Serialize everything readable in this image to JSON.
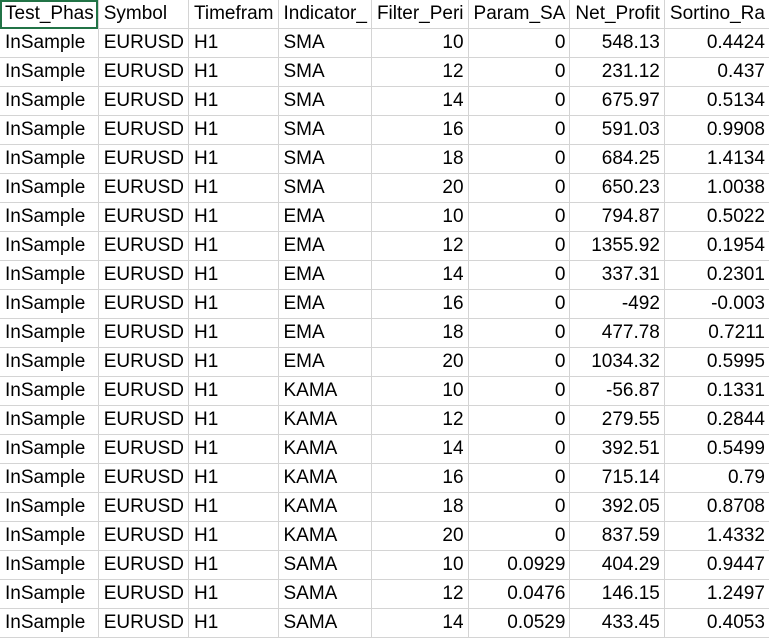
{
  "headers": [
    "Test_Phas",
    "Symbol",
    "Timefram",
    "Indicator_",
    "Filter_Peri",
    "Param_SA",
    "Net_Profit",
    "Sortino_Ra"
  ],
  "rows": [
    [
      "InSample",
      "EURUSD",
      "H1",
      "SMA",
      "10",
      "0",
      "548.13",
      "0.4424"
    ],
    [
      "InSample",
      "EURUSD",
      "H1",
      "SMA",
      "12",
      "0",
      "231.12",
      "0.437"
    ],
    [
      "InSample",
      "EURUSD",
      "H1",
      "SMA",
      "14",
      "0",
      "675.97",
      "0.5134"
    ],
    [
      "InSample",
      "EURUSD",
      "H1",
      "SMA",
      "16",
      "0",
      "591.03",
      "0.9908"
    ],
    [
      "InSample",
      "EURUSD",
      "H1",
      "SMA",
      "18",
      "0",
      "684.25",
      "1.4134"
    ],
    [
      "InSample",
      "EURUSD",
      "H1",
      "SMA",
      "20",
      "0",
      "650.23",
      "1.0038"
    ],
    [
      "InSample",
      "EURUSD",
      "H1",
      "EMA",
      "10",
      "0",
      "794.87",
      "0.5022"
    ],
    [
      "InSample",
      "EURUSD",
      "H1",
      "EMA",
      "12",
      "0",
      "1355.92",
      "0.1954"
    ],
    [
      "InSample",
      "EURUSD",
      "H1",
      "EMA",
      "14",
      "0",
      "337.31",
      "0.2301"
    ],
    [
      "InSample",
      "EURUSD",
      "H1",
      "EMA",
      "16",
      "0",
      "-492",
      "-0.003"
    ],
    [
      "InSample",
      "EURUSD",
      "H1",
      "EMA",
      "18",
      "0",
      "477.78",
      "0.7211"
    ],
    [
      "InSample",
      "EURUSD",
      "H1",
      "EMA",
      "20",
      "0",
      "1034.32",
      "0.5995"
    ],
    [
      "InSample",
      "EURUSD",
      "H1",
      "KAMA",
      "10",
      "0",
      "-56.87",
      "0.1331"
    ],
    [
      "InSample",
      "EURUSD",
      "H1",
      "KAMA",
      "12",
      "0",
      "279.55",
      "0.2844"
    ],
    [
      "InSample",
      "EURUSD",
      "H1",
      "KAMA",
      "14",
      "0",
      "392.51",
      "0.5499"
    ],
    [
      "InSample",
      "EURUSD",
      "H1",
      "KAMA",
      "16",
      "0",
      "715.14",
      "0.79"
    ],
    [
      "InSample",
      "EURUSD",
      "H1",
      "KAMA",
      "18",
      "0",
      "392.05",
      "0.8708"
    ],
    [
      "InSample",
      "EURUSD",
      "H1",
      "KAMA",
      "20",
      "0",
      "837.59",
      "1.4332"
    ],
    [
      "InSample",
      "EURUSD",
      "H1",
      "SAMA",
      "10",
      "0.0929",
      "404.29",
      "0.9447"
    ],
    [
      "InSample",
      "EURUSD",
      "H1",
      "SAMA",
      "12",
      "0.0476",
      "146.15",
      "1.2497"
    ],
    [
      "InSample",
      "EURUSD",
      "H1",
      "SAMA",
      "14",
      "0.0529",
      "433.45",
      "0.4053"
    ]
  ],
  "column_alignment": [
    "left",
    "left",
    "left",
    "left",
    "right",
    "right",
    "right",
    "right"
  ],
  "colors": {
    "gridline": "#d4d4d4",
    "active_cell_border": "#217346",
    "text": "#000000"
  }
}
